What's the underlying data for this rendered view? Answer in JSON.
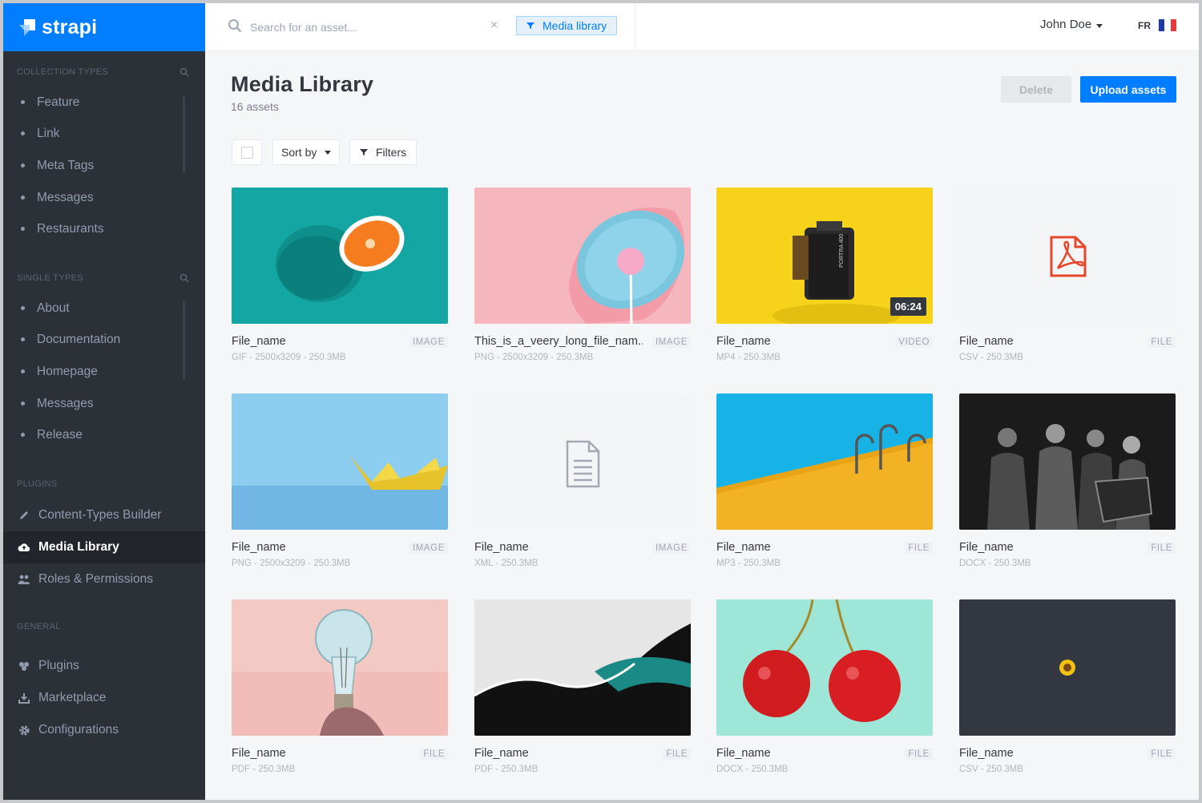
{
  "brand": {
    "name": "strapi"
  },
  "sidebar": {
    "sections": [
      {
        "title": "COLLECTION TYPES",
        "items": [
          "Feature",
          "Link",
          "Meta Tags",
          "Messages",
          "Restaurants"
        ]
      },
      {
        "title": "SINGLE TYPES",
        "items": [
          "About",
          "Documentation",
          "Homepage",
          "Messages",
          "Release"
        ]
      },
      {
        "title": "PLUGINS",
        "items": [
          {
            "label": "Content-Types Builder",
            "icon": "pencil-icon"
          },
          {
            "label": "Media Library",
            "icon": "cloud-icon",
            "active": true
          },
          {
            "label": "Roles & Permissions",
            "icon": "users-icon"
          }
        ]
      },
      {
        "title": "GENERAL",
        "items": [
          {
            "label": "Plugins",
            "icon": "puzzle-icon"
          },
          {
            "label": "Marketplace",
            "icon": "download-icon"
          },
          {
            "label": "Configurations",
            "icon": "gear-icon"
          }
        ]
      }
    ]
  },
  "header": {
    "search_placeholder": "Search for an asset...",
    "filter_tag": "Media library",
    "user": "John Doe",
    "lang": "FR"
  },
  "main": {
    "title": "Media Library",
    "count": "16 assets",
    "delete": "Delete",
    "upload": "Upload assets",
    "sort": "Sort by",
    "filters": "Filters"
  },
  "assets": [
    {
      "name": "File_name",
      "type": "IMAGE",
      "meta": "GIF - 2500x3209 - 250.3MB",
      "art": "orange"
    },
    {
      "name": "This_is_a_veery_long_file_nam...",
      "type": "IMAGE",
      "meta": "PNG - 2500x3209 - 250.3MB",
      "art": "lollipop"
    },
    {
      "name": "File_name",
      "type": "VIDEO",
      "meta": "MP4 - 250.3MB",
      "art": "film",
      "duration": "06:24"
    },
    {
      "name": "File_name",
      "type": "FILE",
      "meta": "CSV - 250.3MB",
      "art": "pdf"
    },
    {
      "name": "File_name",
      "type": "IMAGE",
      "meta": "PNG - 2500x3209 - 250.3MB",
      "art": "boat"
    },
    {
      "name": "File_name",
      "type": "IMAGE",
      "meta": "XML - 250.3MB",
      "art": "doc"
    },
    {
      "name": "File_name",
      "type": "FILE",
      "meta": "MP3 - 250.3MB",
      "art": "pool"
    },
    {
      "name": "File_name",
      "type": "FILE",
      "meta": "DOCX - 250.3MB",
      "art": "band"
    },
    {
      "name": "File_name",
      "type": "FILE",
      "meta": "PDF - 250.3MB",
      "art": "bulb"
    },
    {
      "name": "File_name",
      "type": "FILE",
      "meta": "PDF - 250.3MB",
      "art": "paper"
    },
    {
      "name": "File_name",
      "type": "FILE",
      "meta": "DOCX - 250.3MB",
      "art": "cherry"
    },
    {
      "name": "File_name",
      "type": "FILE",
      "meta": "CSV - 250.3MB",
      "art": "sunflower"
    }
  ],
  "colors": {
    "accent": "#007eff",
    "sidebar": "#2c3138",
    "sidebar_header": "#007eff"
  }
}
